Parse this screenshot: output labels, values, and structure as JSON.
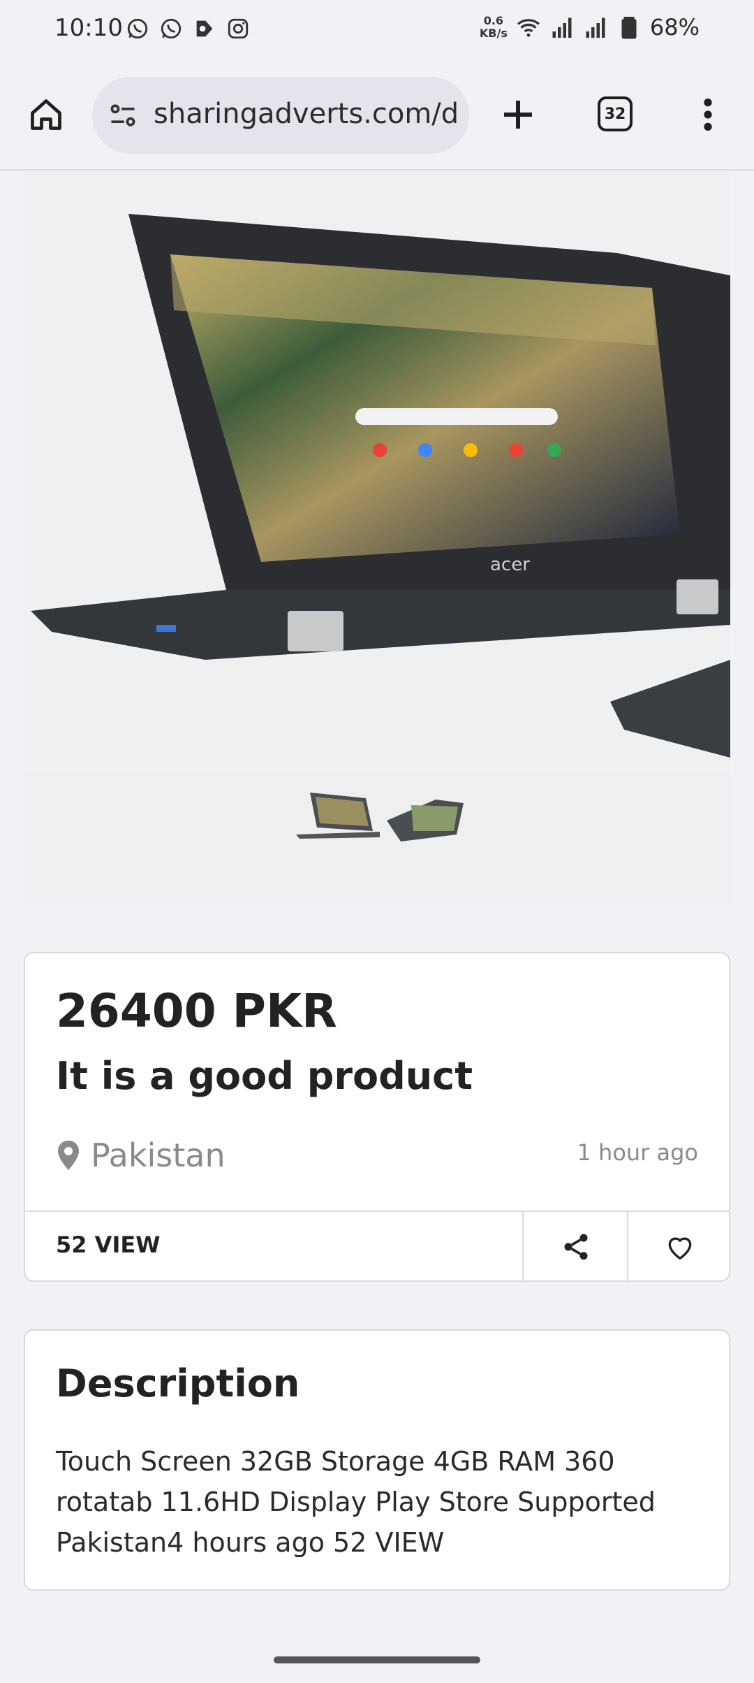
{
  "status_bar": {
    "time": "10:10",
    "net_speed_value": "0.6",
    "net_speed_unit": "KB/s",
    "battery": "68%",
    "notification_icons": [
      "whatsapp-icon",
      "whatsapp-icon",
      "play-games-icon",
      "instagram-icon"
    ]
  },
  "browser": {
    "url": "sharingadverts.com/d",
    "tab_count": "32"
  },
  "listing": {
    "price": "26400 PKR",
    "title": "It is a good product",
    "location": "Pakistan",
    "posted": "1 hour ago",
    "views": "52 VIEW"
  },
  "description": {
    "heading": "Description",
    "body": "Touch Screen 32GB Storage 4GB RAM 360 rotatab 11.6HD Display Play Store Supported Pakistan4 hours ago 52 VIEW"
  },
  "image": {
    "brand_on_laptop": "acer"
  },
  "colors": {
    "page_bg": "#f1f2f6",
    "card_bg": "#ffffff",
    "url_pill": "#e3e4ec",
    "muted_text": "#8a8a8a"
  }
}
